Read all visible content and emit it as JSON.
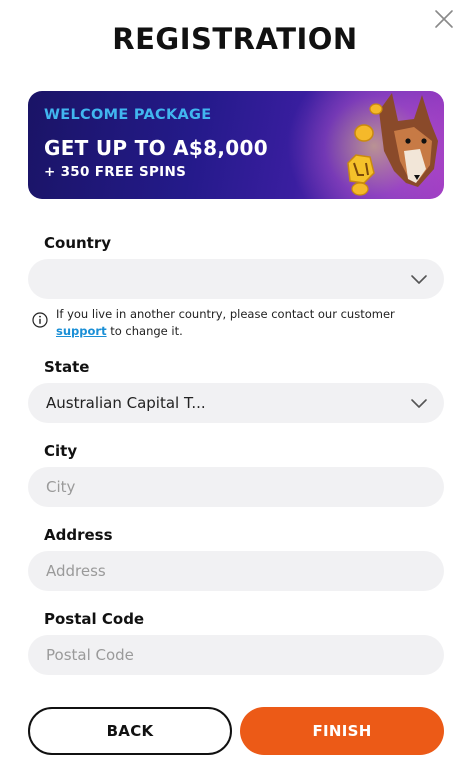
{
  "dialog": {
    "title": "REGISTRATION"
  },
  "banner": {
    "tag": "WELCOME PACKAGE",
    "headline": "GET UP TO A$8,000",
    "subline": "+ 350 FREE SPINS"
  },
  "form": {
    "country": {
      "label": "Country",
      "value": ""
    },
    "info": {
      "text_before": "If you live in another country, please contact our customer",
      "link": "support",
      "text_after": " to change it."
    },
    "state": {
      "label": "State",
      "value": "Australian Capital T..."
    },
    "city": {
      "label": "City",
      "placeholder": "City"
    },
    "address": {
      "label": "Address",
      "placeholder": "Address"
    },
    "postal_code": {
      "label": "Postal Code",
      "placeholder": "Postal Code"
    }
  },
  "actions": {
    "back_label": "BACK",
    "finish_label": "FINISH"
  },
  "colors": {
    "accent": "#ec5a17",
    "link": "#1a8fd6",
    "banner_tag": "#41b6ef",
    "field_bg": "#f1f1f3"
  },
  "icons": [
    "close-icon",
    "chevron-down-icon",
    "info-icon",
    "wolf-art",
    "coin-icon"
  ]
}
